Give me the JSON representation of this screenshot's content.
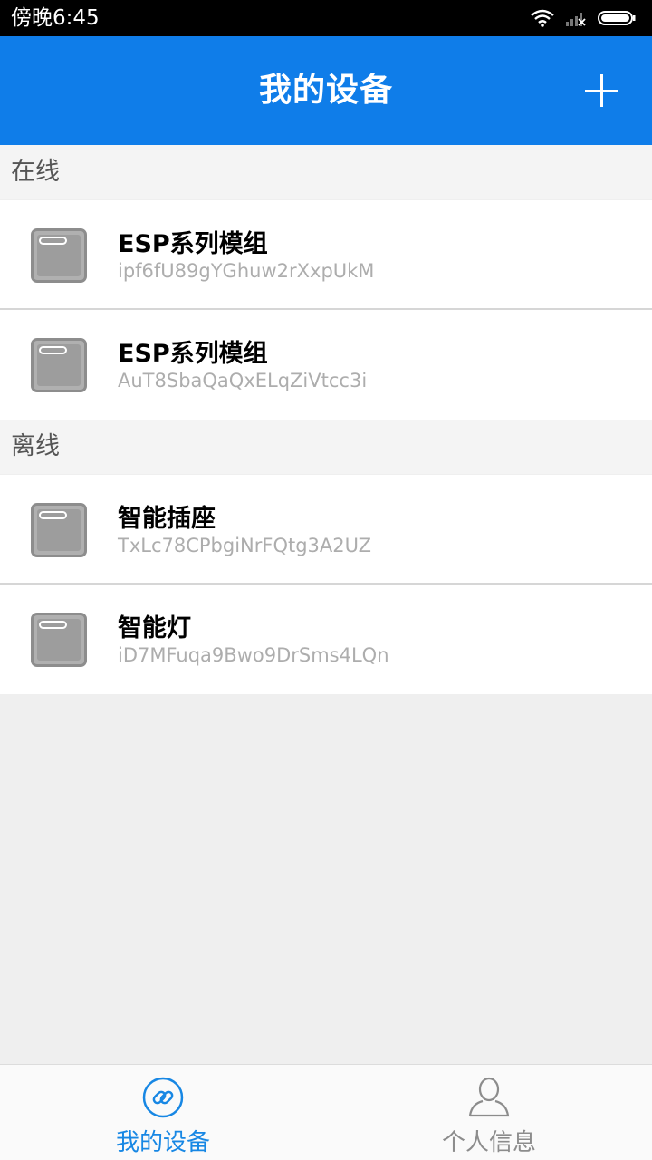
{
  "status_bar": {
    "time": "傍晚6:45"
  },
  "app_bar": {
    "title": "我的设备"
  },
  "sections": {
    "online": {
      "label": "在线"
    },
    "offline": {
      "label": "离线"
    }
  },
  "devices": [
    {
      "name": "ESP系列模组",
      "id": "ipf6fU89gYGhuw2rXxpUkM",
      "status": "online"
    },
    {
      "name": "ESP系列模组",
      "id": "AuT8SbaQaQxELqZiVtcc3i",
      "status": "online"
    },
    {
      "name": "智能插座",
      "id": "TxLc78CPbgiNrFQtg3A2UZ",
      "status": "offline"
    },
    {
      "name": "智能灯",
      "id": "iD7MFuqa9Bwo9DrSms4LQn",
      "status": "offline"
    }
  ],
  "bottom_nav": {
    "items": [
      {
        "label": "我的设备",
        "icon": "link-icon",
        "active": true
      },
      {
        "label": "个人信息",
        "icon": "person-icon",
        "active": false
      }
    ],
    "active_color": "#1787e4",
    "inactive_color": "#8c8c8c"
  },
  "colors": {
    "primary": "#0f7de9"
  }
}
